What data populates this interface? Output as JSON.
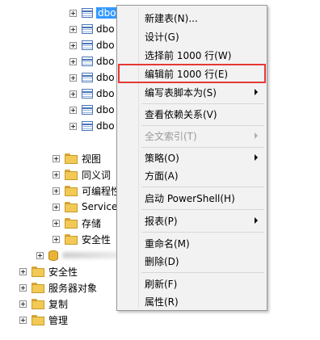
{
  "tree": {
    "table_rows": [
      {
        "label": "dbo",
        "selected": true
      },
      {
        "label": "dbo"
      },
      {
        "label": "dbo"
      },
      {
        "label": "dbo"
      },
      {
        "label": "dbo"
      },
      {
        "label": "dbo"
      },
      {
        "label": "dbo"
      },
      {
        "label": "dbo"
      }
    ],
    "folders": [
      "视图",
      "同义词",
      "可编程性",
      "Service",
      "存储",
      "安全性"
    ],
    "root_folders": [
      "安全性",
      "服务器对象",
      "复制",
      "管理"
    ]
  },
  "context_menu": {
    "items": [
      {
        "label": "新建表(N)...",
        "arrow": false,
        "disabled": false
      },
      {
        "label": "设计(G)",
        "arrow": false,
        "disabled": false
      },
      {
        "label": "选择前 1000 行(W)",
        "arrow": false,
        "disabled": false
      },
      {
        "label": "编辑前 1000 行(E)",
        "arrow": false,
        "disabled": false,
        "highlight": true
      },
      {
        "label": "编写表脚本为(S)",
        "arrow": true,
        "disabled": false
      },
      {
        "label": "查看依赖关系(V)",
        "arrow": false,
        "disabled": false
      },
      {
        "label": "全文索引(T)",
        "arrow": true,
        "disabled": true
      },
      {
        "label": "策略(O)",
        "arrow": true,
        "disabled": false
      },
      {
        "label": "方面(A)",
        "arrow": false,
        "disabled": false
      },
      {
        "label": "启动 PowerShell(H)",
        "arrow": false,
        "disabled": false
      },
      {
        "label": "报表(P)",
        "arrow": true,
        "disabled": false
      },
      {
        "label": "重命名(M)",
        "arrow": false,
        "disabled": false
      },
      {
        "label": "删除(D)",
        "arrow": false,
        "disabled": false
      },
      {
        "label": "刷新(F)",
        "arrow": false,
        "disabled": false
      },
      {
        "label": "属性(R)",
        "arrow": false,
        "disabled": false
      }
    ],
    "highlight_color": "#e53935"
  }
}
